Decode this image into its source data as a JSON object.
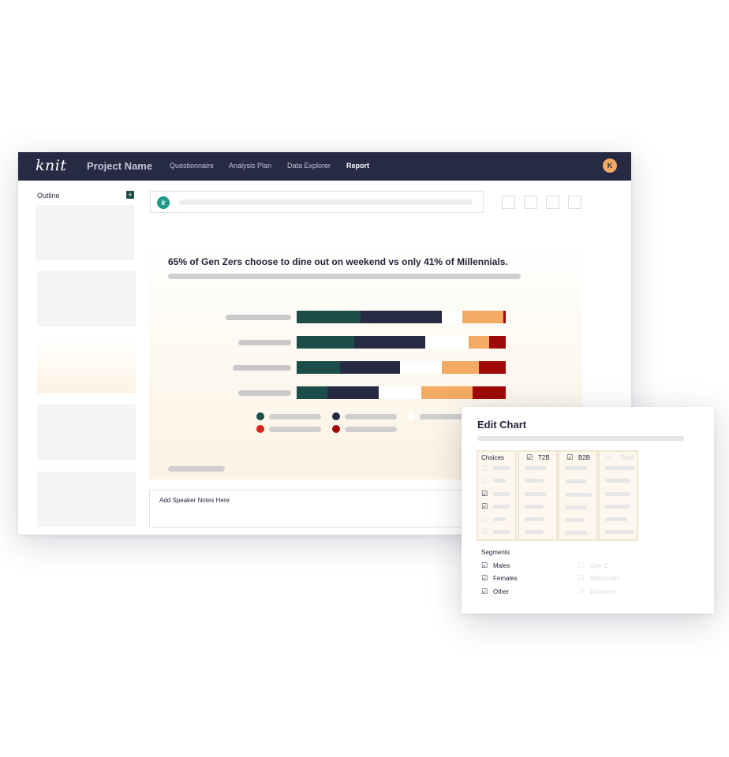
{
  "nav": {
    "logo": "knit",
    "project_name": "Project Name",
    "links": [
      "Questionnaire",
      "Analysis Plan",
      "Data Explorer",
      "Report"
    ],
    "avatar_initial": "K"
  },
  "sidebar": {
    "outline_label": "Outline",
    "add_symbol": "+"
  },
  "toolbar": {
    "k_icon": "k"
  },
  "slide": {
    "title": "65% of Gen Zers choose to dine out on weekend vs only 41% of Millennials."
  },
  "chart_data": {
    "type": "bar",
    "stacked": true,
    "orientation": "horizontal",
    "series_colors": [
      "#1c4d48",
      "#272a43",
      "#ffffff",
      "#f3ab63",
      "#9e0a08"
    ],
    "series": [
      {
        "values": [
          31,
          39,
          10,
          20,
          1
        ]
      },
      {
        "values": [
          28,
          34,
          21,
          10,
          8
        ]
      },
      {
        "values": [
          21,
          29,
          20,
          18,
          13
        ]
      },
      {
        "values": [
          15,
          25,
          21,
          25,
          16
        ]
      }
    ],
    "legend_colors": [
      "#1c4d48",
      "#272a43",
      "#ffffff",
      "#d8241f",
      "#9e0a08"
    ]
  },
  "notes": {
    "placeholder": "Add Speaker Notes Here"
  },
  "edit_chart": {
    "title": "Edit Chart",
    "columns": [
      "Choices",
      "T2B",
      "B2B",
      "Total"
    ],
    "segments_title": "Segments",
    "segments_left": [
      "Males",
      "Females",
      "Other"
    ],
    "segments_right": [
      "Gen Z",
      "Millennials",
      "Boomers"
    ],
    "check_symbol": "☑"
  }
}
